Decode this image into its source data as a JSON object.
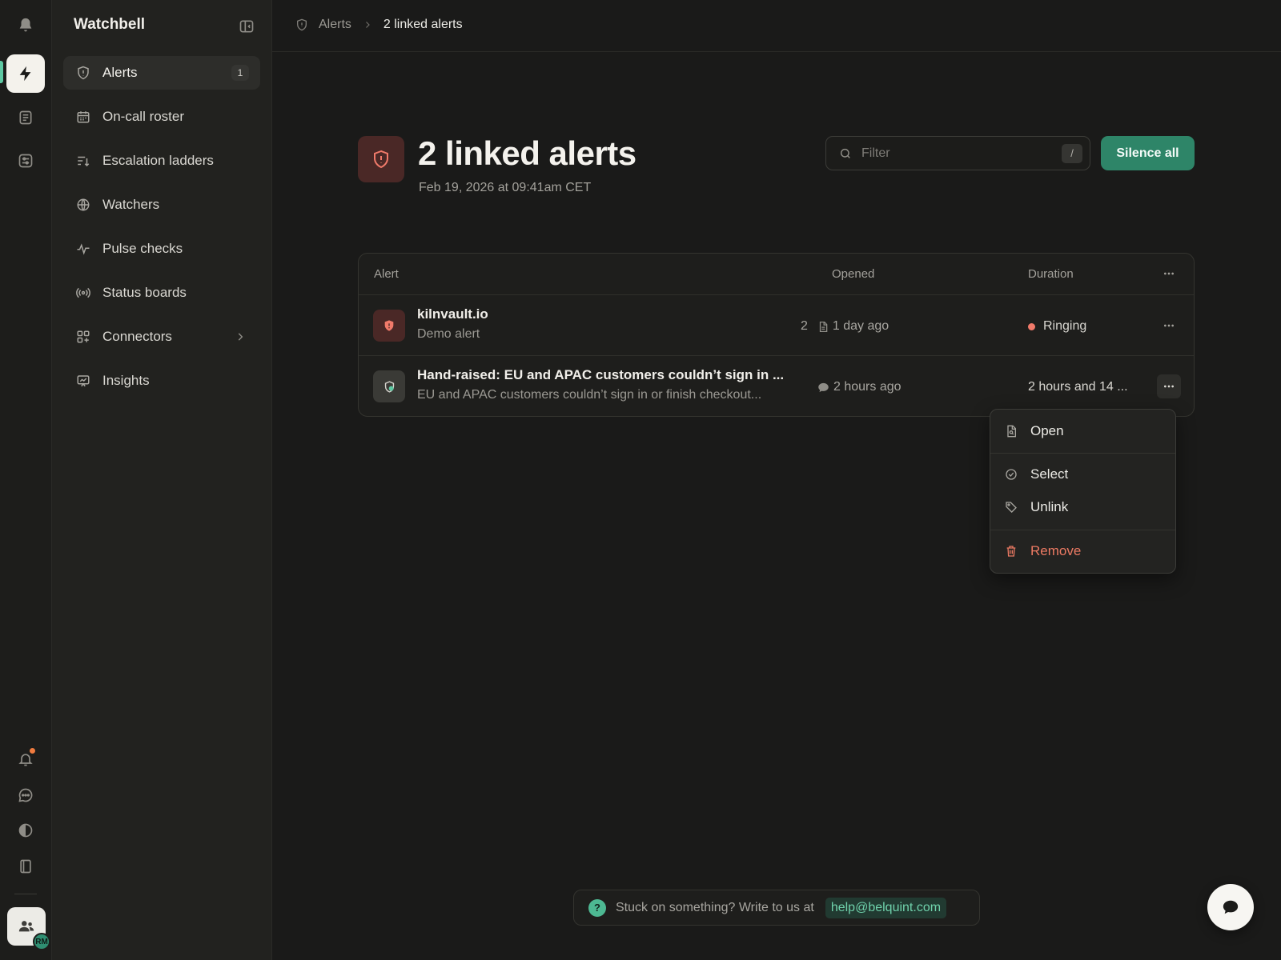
{
  "app": {
    "name": "Watchbell"
  },
  "rail": {
    "icons": [
      "bell-icon",
      "bolt-icon",
      "document-icon",
      "sliders-icon",
      "notification-icon",
      "chat-icon",
      "contrast-icon",
      "book-icon",
      "team-icon"
    ],
    "avatar_initials": "RM",
    "accent_color": "#5ec9a3",
    "notif_dot_color": "#f07b3f"
  },
  "sidebar": {
    "items": [
      {
        "label": "Alerts",
        "icon": "shield-icon",
        "badge": "1",
        "active": true
      },
      {
        "label": "On-call roster",
        "icon": "calendar-icon"
      },
      {
        "label": "Escalation ladders",
        "icon": "sort-icon"
      },
      {
        "label": "Watchers",
        "icon": "globe-icon"
      },
      {
        "label": "Pulse checks",
        "icon": "pulse-icon"
      },
      {
        "label": "Status boards",
        "icon": "broadcast-icon"
      },
      {
        "label": "Connectors",
        "icon": "grid-plus-icon",
        "has_children": true
      },
      {
        "label": "Insights",
        "icon": "chart-icon"
      }
    ]
  },
  "breadcrumb": {
    "parent": "Alerts",
    "current": "2 linked alerts"
  },
  "header": {
    "title": "2 linked alerts",
    "subtitle": "Feb 19, 2026 at 09:41am CET",
    "filter_placeholder": "Filter",
    "filter_value": "",
    "filter_shortcut": "/",
    "silence_label": "Silence all",
    "brand_color": "#2e8568",
    "danger_color": "#f07a6a"
  },
  "table": {
    "columns": [
      "Alert",
      "Opened",
      "Duration"
    ],
    "rows": [
      {
        "title": "kilnvault.io",
        "subtitle": "Demo alert",
        "icon": "shield-alert-icon",
        "count": "2",
        "opened_icon": "document-icon",
        "opened": "1 day ago",
        "duration": "Ringing",
        "status": "ringing"
      },
      {
        "title": "Hand-raised: EU and APAC customers couldn’t sign in ...",
        "subtitle": "EU and APAC customers couldn’t sign in or finish checkout...",
        "icon": "hand-raised-icon",
        "opened_icon": "comment-icon",
        "opened": "2 hours ago",
        "duration": "2 hours and 14 ..."
      }
    ]
  },
  "context_menu": {
    "items": [
      {
        "label": "Open",
        "icon": "file-search-icon"
      },
      {
        "label": "Select",
        "icon": "check-circle-icon"
      },
      {
        "label": "Unlink",
        "icon": "tag-icon"
      },
      {
        "label": "Remove",
        "icon": "trash-icon",
        "danger": true
      }
    ]
  },
  "help": {
    "text": "Stuck on something? Write to us at",
    "email": "help@belquint.com",
    "icon": "question-icon"
  },
  "chat_fab": {
    "icon": "chat-bubble-icon"
  }
}
